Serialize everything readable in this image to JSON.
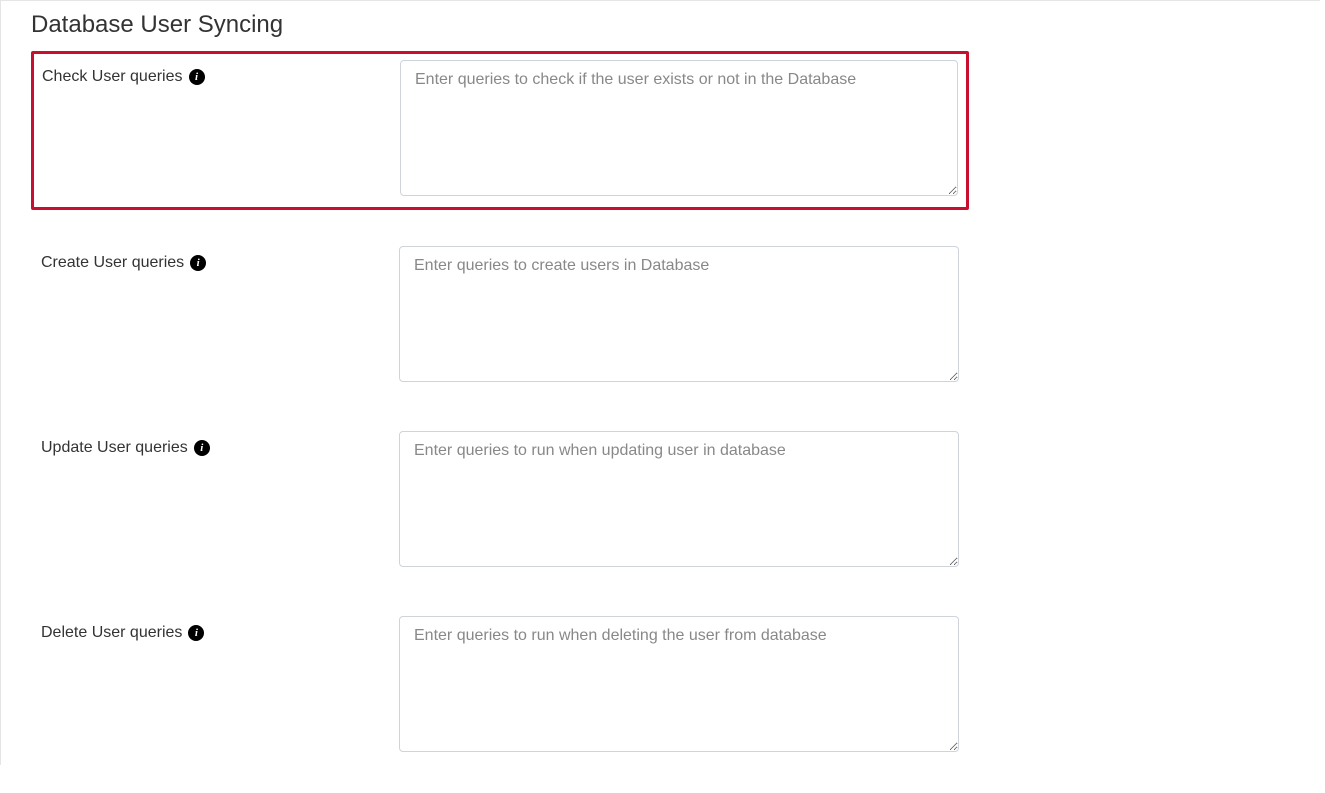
{
  "section": {
    "title": "Database User Syncing"
  },
  "fields": {
    "check": {
      "label": "Check User queries",
      "placeholder": "Enter queries to check if the user exists or not in the Database"
    },
    "create": {
      "label": "Create User queries",
      "placeholder": "Enter queries to create users in Database"
    },
    "update": {
      "label": "Update User queries",
      "placeholder": "Enter queries to run when updating user in database"
    },
    "delete": {
      "label": "Delete User queries",
      "placeholder": "Enter queries to run when deleting the user from database"
    }
  },
  "icons": {
    "info_glyph": "i"
  }
}
